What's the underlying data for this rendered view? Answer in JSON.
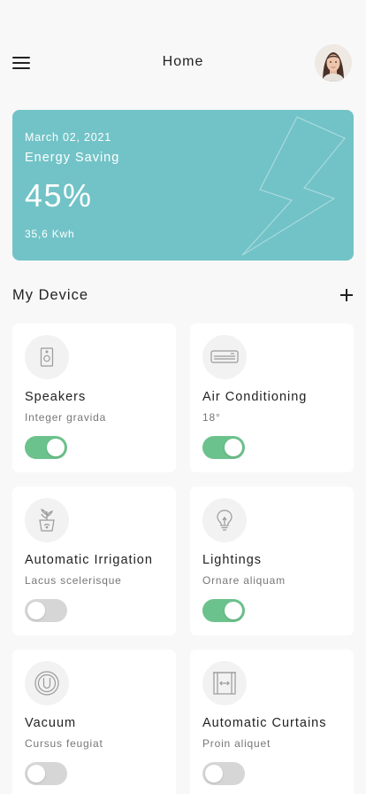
{
  "header": {
    "title": "Home",
    "menu_icon": "hamburger-icon",
    "avatar": "user-avatar"
  },
  "energy": {
    "date": "March 02, 2021",
    "label": "Energy Saving",
    "percent": "45%",
    "kwh": "35,6 Kwh",
    "icon": "lightning-bolt-icon",
    "color": "#72c3c7"
  },
  "devices_section": {
    "title": "My Device",
    "add_icon": "plus-icon"
  },
  "devices": [
    {
      "name": "Speakers",
      "sub": "Integer gravida",
      "on": true,
      "icon": "speaker-icon"
    },
    {
      "name": "Air Conditioning",
      "sub": "18°",
      "on": true,
      "icon": "air-conditioner-icon"
    },
    {
      "name": "Automatic Irrigation",
      "sub": "Lacus scelerisque",
      "on": false,
      "icon": "plant-pot-icon"
    },
    {
      "name": "Lightings",
      "sub": "Ornare aliquam",
      "on": true,
      "icon": "light-bulb-icon"
    },
    {
      "name": "Vacuum",
      "sub": "Cursus feugiat",
      "on": false,
      "icon": "vacuum-icon"
    },
    {
      "name": "Automatic Curtains",
      "sub": "Proin aliquet",
      "on": false,
      "icon": "curtains-icon"
    }
  ],
  "colors": {
    "toggle_on": "#6cc28c",
    "toggle_off": "#d6d6d6",
    "background": "#f8f8f8"
  }
}
